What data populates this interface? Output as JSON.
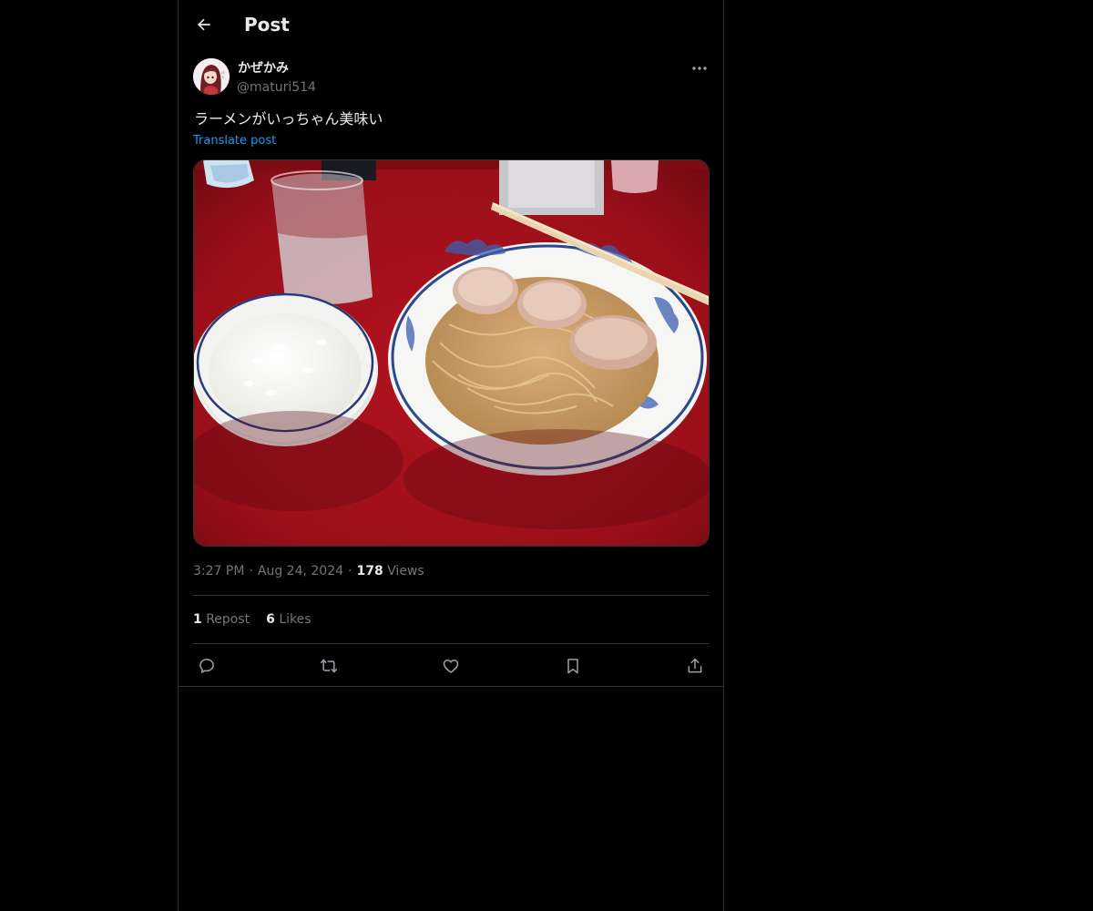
{
  "header": {
    "title": "Post",
    "back_icon": "arrow-left-icon"
  },
  "author": {
    "display_name": "かぜかみ",
    "handle": "@maturi514",
    "avatar_icon": "anime-girl-avatar"
  },
  "post": {
    "text": "ラーメンがいっちゃん美味い",
    "translate_label": "Translate post",
    "image_description_icon": "ramen-and-rice-photo"
  },
  "meta": {
    "time": "3:27 PM",
    "date": "Aug 24, 2024",
    "views_count": "178",
    "views_label": "Views",
    "separator": "·"
  },
  "stats": {
    "reposts_count": "1",
    "reposts_label": "Repost",
    "likes_count": "6",
    "likes_label": "Likes"
  },
  "actions": [
    {
      "name": "reply",
      "icon": "reply-icon"
    },
    {
      "name": "repost",
      "icon": "repost-icon"
    },
    {
      "name": "like",
      "icon": "heart-icon"
    },
    {
      "name": "bookmark",
      "icon": "bookmark-icon"
    },
    {
      "name": "share",
      "icon": "share-icon"
    }
  ],
  "colors": {
    "background": "#000000",
    "text": "#e7e9ea",
    "secondary_text": "#71767b",
    "link": "#1d9bf0",
    "border": "#2f3336"
  }
}
